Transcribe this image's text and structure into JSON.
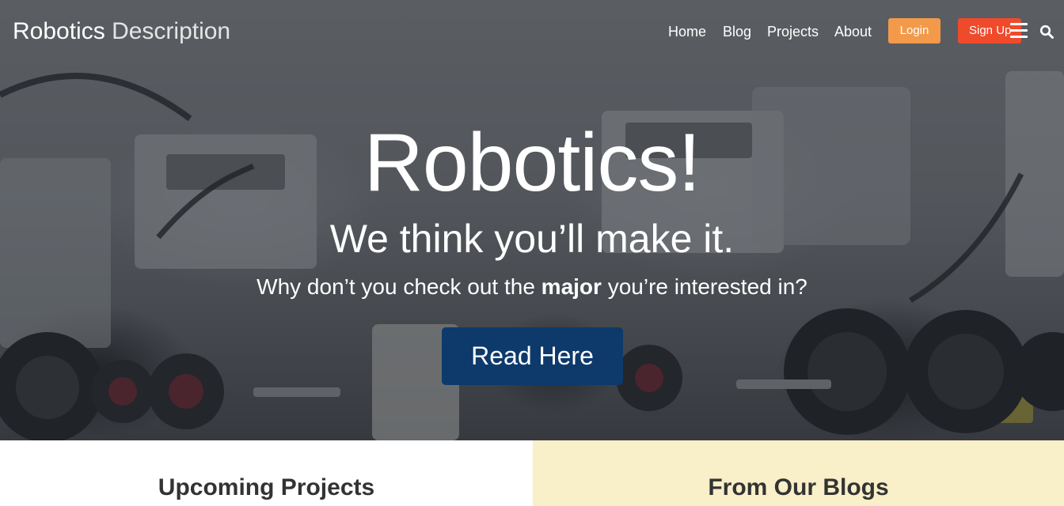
{
  "navbar": {
    "brand_strong": "Robotics",
    "brand_light": "Description",
    "links": [
      "Home",
      "Blog",
      "Projects",
      "About"
    ],
    "login_label": "Login",
    "signup_label": "Sign Up",
    "menu_icon": "hamburger-menu-icon",
    "search_icon": "search-icon"
  },
  "hero": {
    "title": "Robotics!",
    "subtitle": "We think you’ll make it.",
    "question_before": "Why don’t you check out the ",
    "question_bold": "major",
    "question_after": " you’re interested in?",
    "button_label": "Read Here"
  },
  "sections": {
    "left_heading": "Upcoming Projects",
    "right_heading": "From Our Blogs"
  },
  "colors": {
    "login": "#f29a4a",
    "signup": "#f04a2c",
    "read_button": "#0d3a6b",
    "blogs_panel": "#f9efc8"
  }
}
